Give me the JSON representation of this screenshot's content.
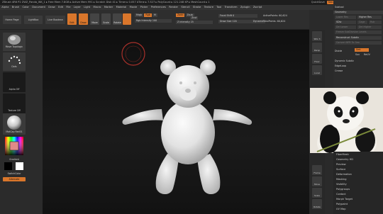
{
  "titlebar": {
    "text": "ZBrush 4R6 P2    ZWZ_Panda_WK_1 ▸ Free Mem 7.8GB ▸ Active Mem 991 ▸ Scratch Disk 41 ▸ Timer ▸ 0.057 ATime ▸ 7.527 ▸ PolyCount ▸ 121.248 KP ▸ MeshCount ▸ 1",
    "quicksave": "QuickSave",
    "seethrough": "See-through  0",
    "menus": "Menus",
    "script": "DefaultZScript"
  },
  "menubar": [
    "Alpha",
    "Brush",
    "Color",
    "Document",
    "Draw",
    "Edit",
    "File",
    "Layer",
    "Light",
    "Macro",
    "Marker",
    "Material",
    "Movie",
    "Picker",
    "Preferences",
    "Render",
    "Stencil",
    "Stroke",
    "Texture",
    "Tool",
    "Transform",
    "Zplugin",
    "Zscript"
  ],
  "toolbar": {
    "home_page": "Home Page",
    "lightbox": "LightBox",
    "live_boolean": "Live Boolean",
    "tools": [
      "Edit",
      "Draw",
      "Move",
      "Scale",
      "Rotate"
    ],
    "mrgb": "Mrgb",
    "rgb": "Rgb",
    "rgb_val": "M",
    "zadd": "Zadd",
    "zsub": "Zsub",
    "zcut": "Zcut",
    "rgb_intensity": "Rgb Intensity 100",
    "z_intensity": "Z Intensity 25",
    "focal_shift": "Focal Shift 0",
    "draw_size": "Draw Size 120",
    "dynamic": "Dynamic",
    "active_points": "ActivePoints: 60,624",
    "total_points": "TotalPoints: 60,624"
  },
  "leftshelf": {
    "brush": "Move Topologic",
    "stroke": "Dots",
    "alpha": "Alpha Off",
    "texture": "Texture Off",
    "material": "MatCap Red01",
    "gradient": "Gradient",
    "switch_color": "SwitchColor",
    "alternate": "Alternate"
  },
  "viewport_buttons": [
    "SPix 3",
    "Persp",
    "Floor",
    "Local",
    "Frame",
    "Move",
    "Scale",
    "Rotate"
  ],
  "rpanel": {
    "subtool": "Subtool",
    "geometry": "Geometry",
    "lower_res": "Lower Res",
    "higher_res": "Higher Res",
    "sdiv": "SDiv",
    "cage": "Cage",
    "rstr": "Rstr",
    "del_lower": "Del Lower",
    "del_higher": "Del Higher",
    "freeze": "Freeze SubDivision Levels",
    "reconstruct": "Reconstruct Subdiv",
    "convert": "Convert BPR To Geo",
    "divide": "Divide",
    "smt": "Smt",
    "suv": "Suv",
    "reuv": "ReUV",
    "dynamic_subdiv": "Dynamic Subdiv",
    "edgeloop": "EdgeLoop",
    "crease": "Crease"
  },
  "bottom_menu": [
    "FiberMesh",
    "Geometry HD",
    "Preview",
    "Surface",
    "Deformation",
    "Masking",
    "Visibility",
    "Polygroups",
    "Contact",
    "Morph Target",
    "Polypaint",
    "UV Map"
  ],
  "colors": {
    "accent": "#d9762b",
    "canvas": "#141414",
    "panel": "#2c2c2c"
  }
}
